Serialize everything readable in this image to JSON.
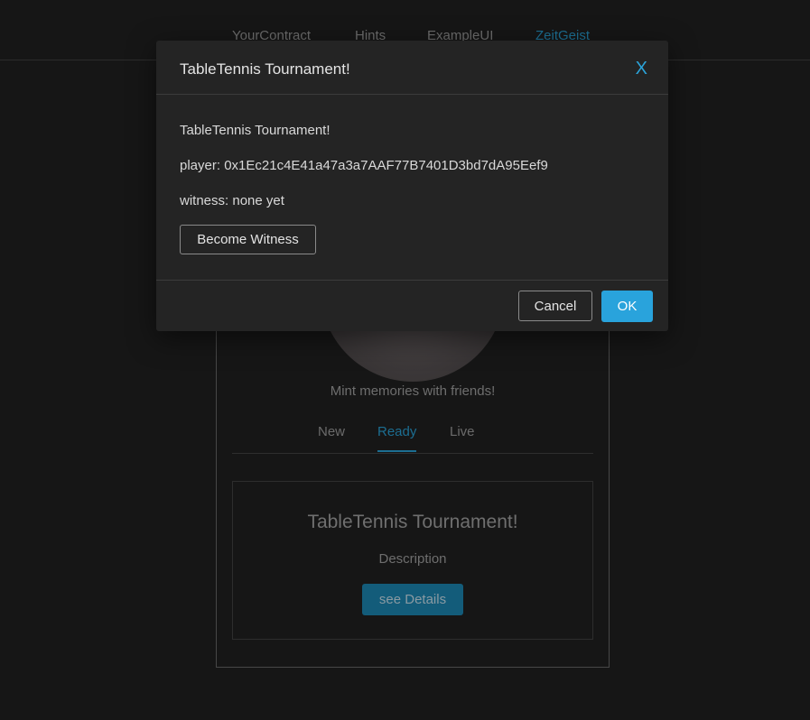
{
  "nav": {
    "items": [
      {
        "label": "YourContract"
      },
      {
        "label": "Hints"
      },
      {
        "label": "ExampleUI"
      },
      {
        "label": "ZeitGeist",
        "active": true
      }
    ]
  },
  "card": {
    "tagline": "Mint memories with friends!",
    "tabs": [
      {
        "label": "New"
      },
      {
        "label": "Ready",
        "active": true
      },
      {
        "label": "Live"
      }
    ],
    "item": {
      "title": "TableTennis Tournament!",
      "description": "Description",
      "details_label": "see Details"
    }
  },
  "modal": {
    "title": "TableTennis Tournament!",
    "close_label": "X",
    "body_title": "TableTennis Tournament!",
    "player_line": "player: 0x1Ec21c4E41a47a3a7AAF77B7401D3bd7dA95Eef9",
    "witness_line": "witness: none yet",
    "witness_button_label": "Become Witness",
    "cancel_label": "Cancel",
    "ok_label": "OK"
  },
  "colors": {
    "accent": "#29a3dc",
    "background": "#161616",
    "modal_bg": "#242424"
  }
}
